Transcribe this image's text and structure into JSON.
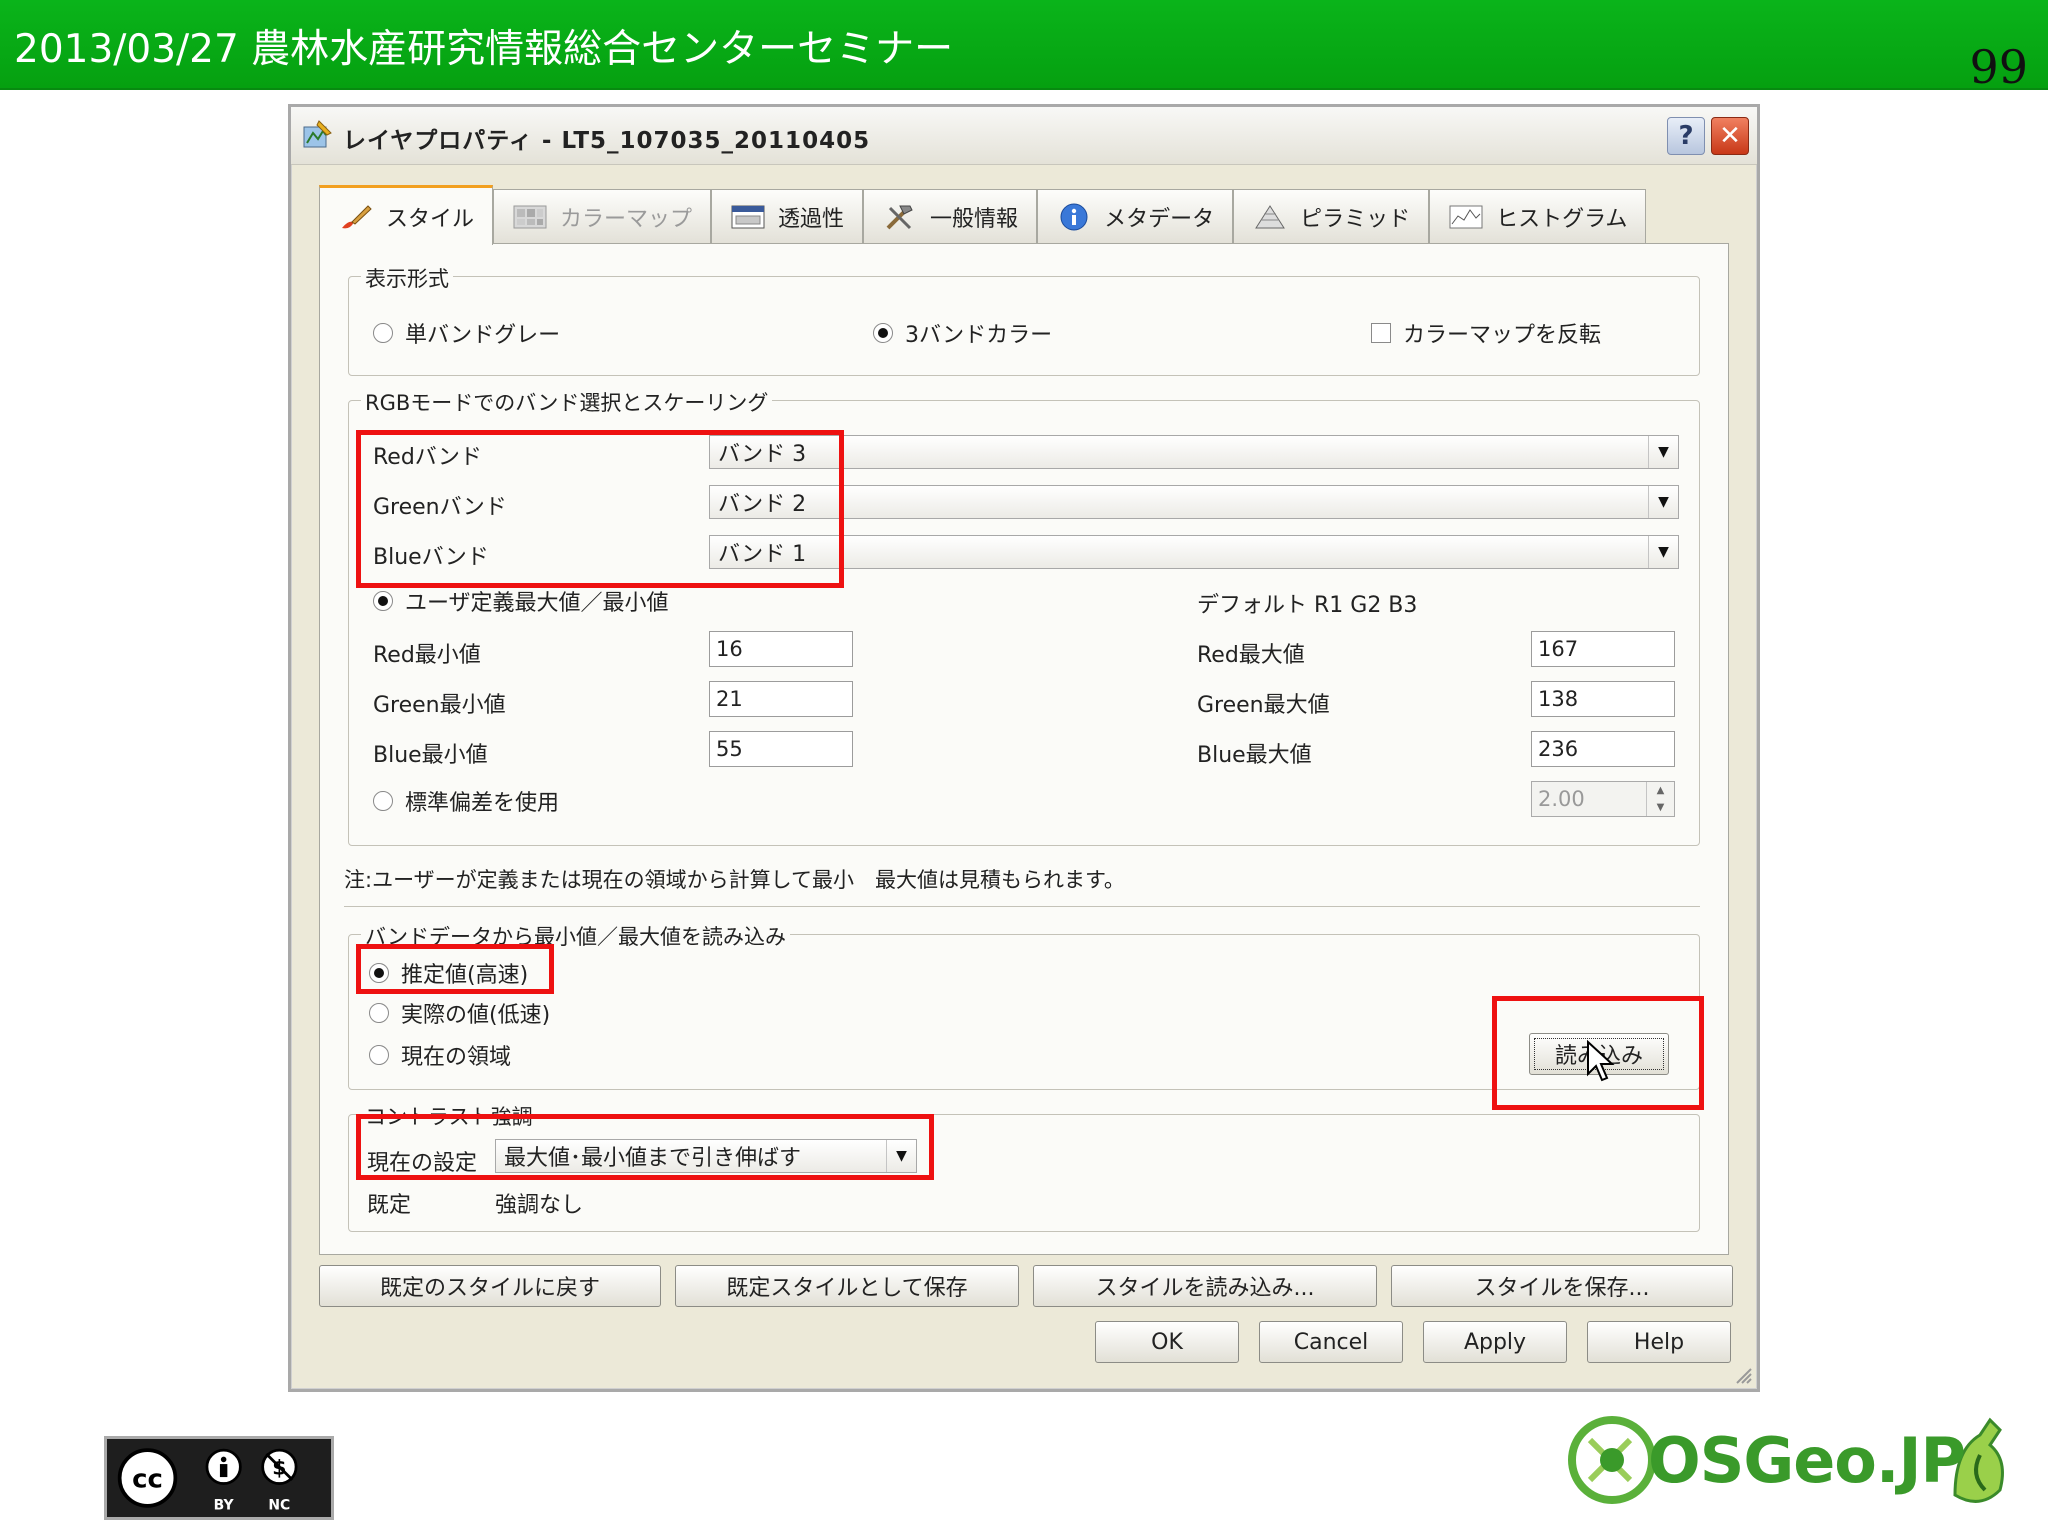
{
  "slide": {
    "title": "2013/03/27 農林水産研究情報総合センターセミナー",
    "page_number": "99"
  },
  "window": {
    "title": "レイヤプロパティ - LT5_107035_20110405",
    "help_glyph": "?",
    "close_glyph": "✕"
  },
  "tabs": [
    {
      "label": "スタイル",
      "active": true
    },
    {
      "label": "カラーマップ",
      "disabled": true
    },
    {
      "label": "透過性"
    },
    {
      "label": "一般情報"
    },
    {
      "label": "メタデータ"
    },
    {
      "label": "ピラミッド"
    },
    {
      "label": "ヒストグラム"
    }
  ],
  "display_format": {
    "title": "表示形式",
    "single_band_gray": "単バンドグレー",
    "three_band_color": "3バンドカラー",
    "invert_colormap": "カラーマップを反転"
  },
  "rgb": {
    "title": "RGBモードでのバンド選択とスケーリング",
    "red_label": "Redバンド",
    "red_value": "バンド 3",
    "green_label": "Greenバンド",
    "green_value": "バンド 2",
    "blue_label": "Blueバンド",
    "blue_value": "バンド 1",
    "user_defined": "ユーザ定義最大値／最小値",
    "default_text": "デフォルト R1 G2 B3",
    "red_min_label": "Red最小値",
    "red_min": "16",
    "green_min_label": "Green最小値",
    "green_min": "21",
    "blue_min_label": "Blue最小値",
    "blue_min": "55",
    "red_max_label": "Red最大値",
    "red_max": "167",
    "green_max_label": "Green最大値",
    "green_max": "138",
    "blue_max_label": "Blue最大値",
    "blue_max": "236",
    "use_stddev": "標準偏差を使用",
    "stddev_value": "2.00"
  },
  "note": "注:ユーザーが定義または現在の領域から計算して最小　最大値は見積もられます。",
  "load_minmax": {
    "title": "バンドデータから最小値／最大値を読み込み",
    "estimate": "推定値(高速)",
    "actual": "実際の値(低速)",
    "current_extent": "現在の領域",
    "load_button": "読み込み"
  },
  "contrast": {
    "title": "コントラスト強調",
    "current_label": "現在の設定",
    "current_value": "最大値･最小値まで引き伸ばす",
    "default_label": "既定",
    "default_value": "強調なし"
  },
  "style_buttons": {
    "restore_default": "既定のスタイルに戻す",
    "save_as_default": "既定スタイルとして保存",
    "load_style": "スタイルを読み込み...",
    "save_style": "スタイルを保存..."
  },
  "dialog_buttons": {
    "ok": "OK",
    "cancel": "Cancel",
    "apply": "Apply",
    "help": "Help"
  },
  "footer": {
    "osgeo": "OSGeo.JP"
  },
  "colors": {
    "header_green": "#0ab41a",
    "highlight_red": "#ee1111",
    "dialog_bg": "#ece9d8",
    "active_tab_accent": "#f2a020"
  }
}
